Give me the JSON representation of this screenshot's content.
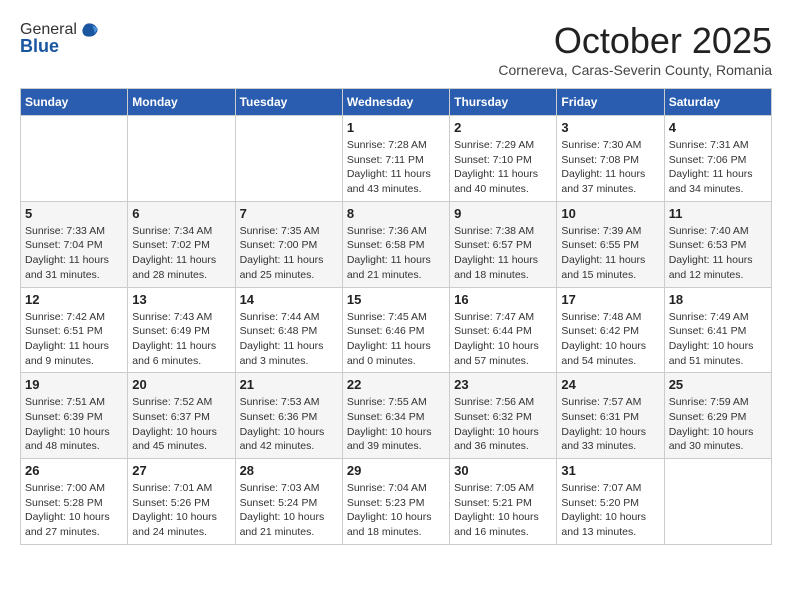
{
  "logo": {
    "line1": "General",
    "line2": "Blue"
  },
  "title": "October 2025",
  "subtitle": "Cornereva, Caras-Severin County, Romania",
  "days_of_week": [
    "Sunday",
    "Monday",
    "Tuesday",
    "Wednesday",
    "Thursday",
    "Friday",
    "Saturday"
  ],
  "weeks": [
    [
      {
        "day": "",
        "info": ""
      },
      {
        "day": "",
        "info": ""
      },
      {
        "day": "",
        "info": ""
      },
      {
        "day": "1",
        "info": "Sunrise: 7:28 AM\nSunset: 7:11 PM\nDaylight: 11 hours and 43 minutes."
      },
      {
        "day": "2",
        "info": "Sunrise: 7:29 AM\nSunset: 7:10 PM\nDaylight: 11 hours and 40 minutes."
      },
      {
        "day": "3",
        "info": "Sunrise: 7:30 AM\nSunset: 7:08 PM\nDaylight: 11 hours and 37 minutes."
      },
      {
        "day": "4",
        "info": "Sunrise: 7:31 AM\nSunset: 7:06 PM\nDaylight: 11 hours and 34 minutes."
      }
    ],
    [
      {
        "day": "5",
        "info": "Sunrise: 7:33 AM\nSunset: 7:04 PM\nDaylight: 11 hours and 31 minutes."
      },
      {
        "day": "6",
        "info": "Sunrise: 7:34 AM\nSunset: 7:02 PM\nDaylight: 11 hours and 28 minutes."
      },
      {
        "day": "7",
        "info": "Sunrise: 7:35 AM\nSunset: 7:00 PM\nDaylight: 11 hours and 25 minutes."
      },
      {
        "day": "8",
        "info": "Sunrise: 7:36 AM\nSunset: 6:58 PM\nDaylight: 11 hours and 21 minutes."
      },
      {
        "day": "9",
        "info": "Sunrise: 7:38 AM\nSunset: 6:57 PM\nDaylight: 11 hours and 18 minutes."
      },
      {
        "day": "10",
        "info": "Sunrise: 7:39 AM\nSunset: 6:55 PM\nDaylight: 11 hours and 15 minutes."
      },
      {
        "day": "11",
        "info": "Sunrise: 7:40 AM\nSunset: 6:53 PM\nDaylight: 11 hours and 12 minutes."
      }
    ],
    [
      {
        "day": "12",
        "info": "Sunrise: 7:42 AM\nSunset: 6:51 PM\nDaylight: 11 hours and 9 minutes."
      },
      {
        "day": "13",
        "info": "Sunrise: 7:43 AM\nSunset: 6:49 PM\nDaylight: 11 hours and 6 minutes."
      },
      {
        "day": "14",
        "info": "Sunrise: 7:44 AM\nSunset: 6:48 PM\nDaylight: 11 hours and 3 minutes."
      },
      {
        "day": "15",
        "info": "Sunrise: 7:45 AM\nSunset: 6:46 PM\nDaylight: 11 hours and 0 minutes."
      },
      {
        "day": "16",
        "info": "Sunrise: 7:47 AM\nSunset: 6:44 PM\nDaylight: 10 hours and 57 minutes."
      },
      {
        "day": "17",
        "info": "Sunrise: 7:48 AM\nSunset: 6:42 PM\nDaylight: 10 hours and 54 minutes."
      },
      {
        "day": "18",
        "info": "Sunrise: 7:49 AM\nSunset: 6:41 PM\nDaylight: 10 hours and 51 minutes."
      }
    ],
    [
      {
        "day": "19",
        "info": "Sunrise: 7:51 AM\nSunset: 6:39 PM\nDaylight: 10 hours and 48 minutes."
      },
      {
        "day": "20",
        "info": "Sunrise: 7:52 AM\nSunset: 6:37 PM\nDaylight: 10 hours and 45 minutes."
      },
      {
        "day": "21",
        "info": "Sunrise: 7:53 AM\nSunset: 6:36 PM\nDaylight: 10 hours and 42 minutes."
      },
      {
        "day": "22",
        "info": "Sunrise: 7:55 AM\nSunset: 6:34 PM\nDaylight: 10 hours and 39 minutes."
      },
      {
        "day": "23",
        "info": "Sunrise: 7:56 AM\nSunset: 6:32 PM\nDaylight: 10 hours and 36 minutes."
      },
      {
        "day": "24",
        "info": "Sunrise: 7:57 AM\nSunset: 6:31 PM\nDaylight: 10 hours and 33 minutes."
      },
      {
        "day": "25",
        "info": "Sunrise: 7:59 AM\nSunset: 6:29 PM\nDaylight: 10 hours and 30 minutes."
      }
    ],
    [
      {
        "day": "26",
        "info": "Sunrise: 7:00 AM\nSunset: 5:28 PM\nDaylight: 10 hours and 27 minutes."
      },
      {
        "day": "27",
        "info": "Sunrise: 7:01 AM\nSunset: 5:26 PM\nDaylight: 10 hours and 24 minutes."
      },
      {
        "day": "28",
        "info": "Sunrise: 7:03 AM\nSunset: 5:24 PM\nDaylight: 10 hours and 21 minutes."
      },
      {
        "day": "29",
        "info": "Sunrise: 7:04 AM\nSunset: 5:23 PM\nDaylight: 10 hours and 18 minutes."
      },
      {
        "day": "30",
        "info": "Sunrise: 7:05 AM\nSunset: 5:21 PM\nDaylight: 10 hours and 16 minutes."
      },
      {
        "day": "31",
        "info": "Sunrise: 7:07 AM\nSunset: 5:20 PM\nDaylight: 10 hours and 13 minutes."
      },
      {
        "day": "",
        "info": ""
      }
    ]
  ]
}
